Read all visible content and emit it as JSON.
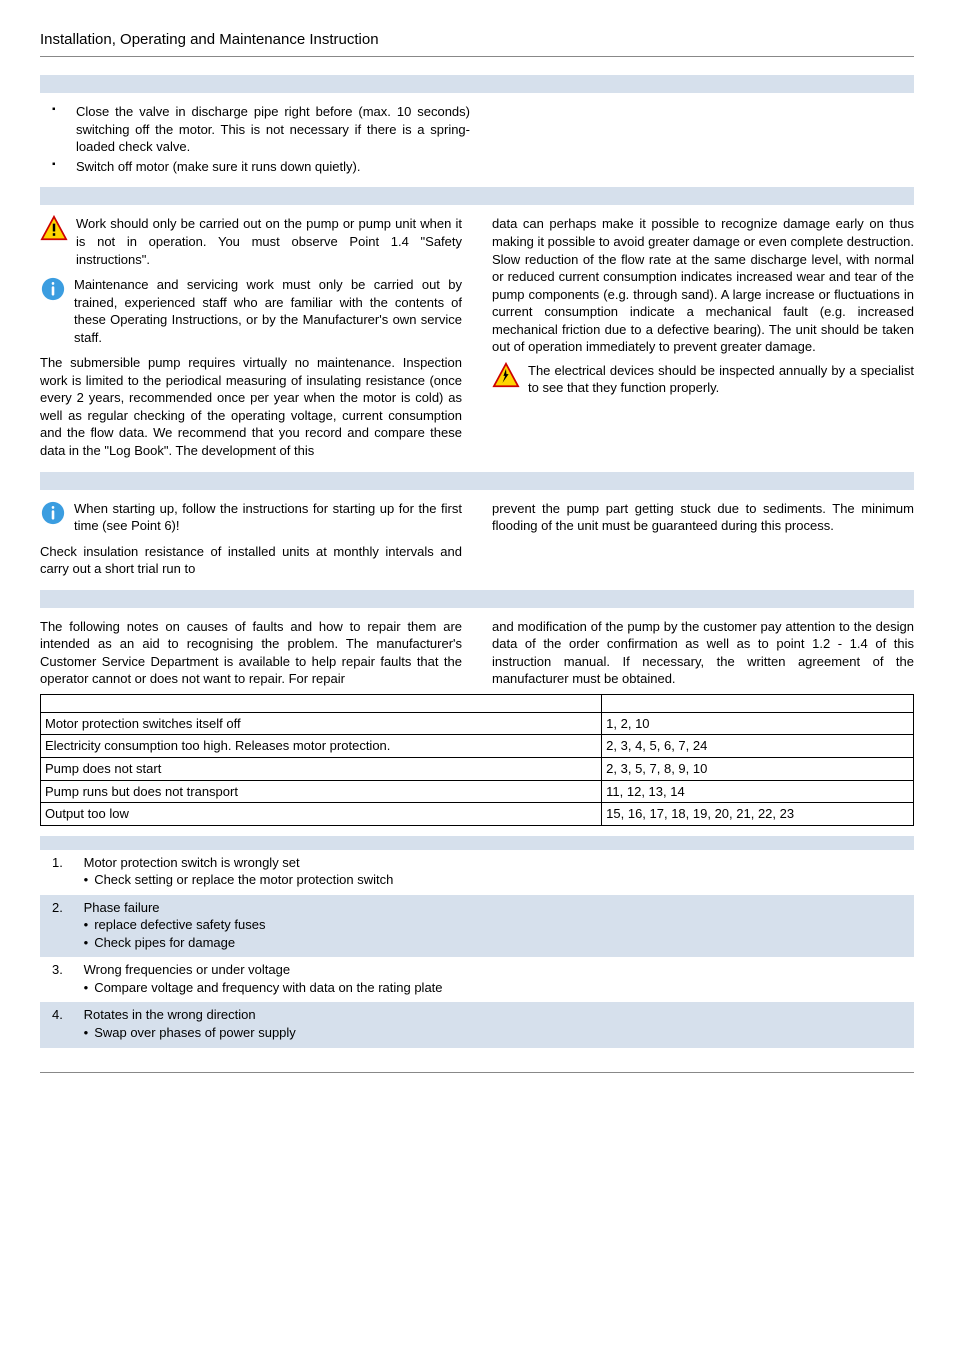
{
  "header": "Installation, Operating and Maintenance Instruction",
  "shutdown": {
    "items": [
      "Close the valve in discharge pipe right before (max. 10 seconds) switching off the motor. This is not necessary if there is a spring-loaded check valve.",
      "Switch off motor (make sure it runs down quietly)."
    ]
  },
  "maint": {
    "warn1": "Work should only be carried out on the pump or pump unit when it is not in operation. You must observe Point 1.4 \"Safety instructions\".",
    "info1": "Maintenance and servicing work must only be carried out by trained, experienced staff who are familiar with the contents of these Operating Instructions, or by the Manufacturer's own service staff.",
    "left_body": "The submersible pump requires virtually no maintenance. Inspection work is limited to the periodical measuring of insulating resistance (once every 2 years, recommended once per year when the motor is cold) as well as regular checking of the operating voltage, current consumption and the flow data. We recommend that you record and compare these data in the \"Log Book\". The development of this",
    "right_body1": "data can perhaps make it possible to recognize damage early on thus making it possible to avoid greater damage or even complete destruction.",
    "right_body2": "Slow reduction of the flow rate at the same discharge level, with normal or reduced current consumption indicates increased wear and tear of the pump components (e.g. through sand). A large increase or fluctuations in current consumption indicate a mechanical fault (e.g. increased mechanical friction due to a defective bearing). The unit should be taken out of operation immediately to prevent greater damage.",
    "warn2": "The electrical devices should be inspected annually by a specialist to see that they function properly."
  },
  "standstill": {
    "info": "When starting up, follow the instructions for starting up for the first time (see Point 6)!",
    "left": "Check insulation resistance of installed units at monthly intervals and carry out a short trial run to",
    "right": "prevent the pump part getting stuck due to sediments. The minimum flooding of the unit must be guaranteed during this process."
  },
  "faults": {
    "left": "The following notes on causes of faults and how to repair them are intended as an aid to recognising the problem. The manufacturer's Customer Service Department is available to help repair faults that the operator cannot or does not want to repair. For repair",
    "right": "and modification of the pump by the customer pay attention to the design data of the order confirmation as well as to point 1.2 - 1.4 of this instruction manual. If necessary, the written agreement of the manufacturer must be obtained.",
    "table": [
      {
        "fault": "Motor protection switches itself off",
        "codes": "1, 2, 10"
      },
      {
        "fault": "Electricity consumption too high. Releases motor protection.",
        "codes": "2, 3, 4, 5, 6, 7, 24"
      },
      {
        "fault": "Pump does not start",
        "codes": "2, 3, 5, 7, 8, 9, 10"
      },
      {
        "fault": "Pump runs but does not transport",
        "codes": "11, 12, 13, 14"
      },
      {
        "fault": "Output too low",
        "codes": "15, 16, 17, 18, 19, 20, 21, 22, 23"
      }
    ]
  },
  "remedies": [
    {
      "num": "1.",
      "title": "Motor protection switch is wrongly set",
      "subs": [
        "Check setting or replace the motor protection switch"
      ],
      "shaded": false
    },
    {
      "num": "2.",
      "title": "Phase failure",
      "subs": [
        "replace defective safety fuses",
        "Check pipes for damage"
      ],
      "shaded": true
    },
    {
      "num": "3.",
      "title": "Wrong frequencies or under voltage",
      "subs": [
        "Compare voltage and frequency with data on the rating plate"
      ],
      "shaded": false
    },
    {
      "num": "4.",
      "title": "Rotates in the wrong direction",
      "subs": [
        "Swap over phases of power supply"
      ],
      "shaded": true
    }
  ]
}
